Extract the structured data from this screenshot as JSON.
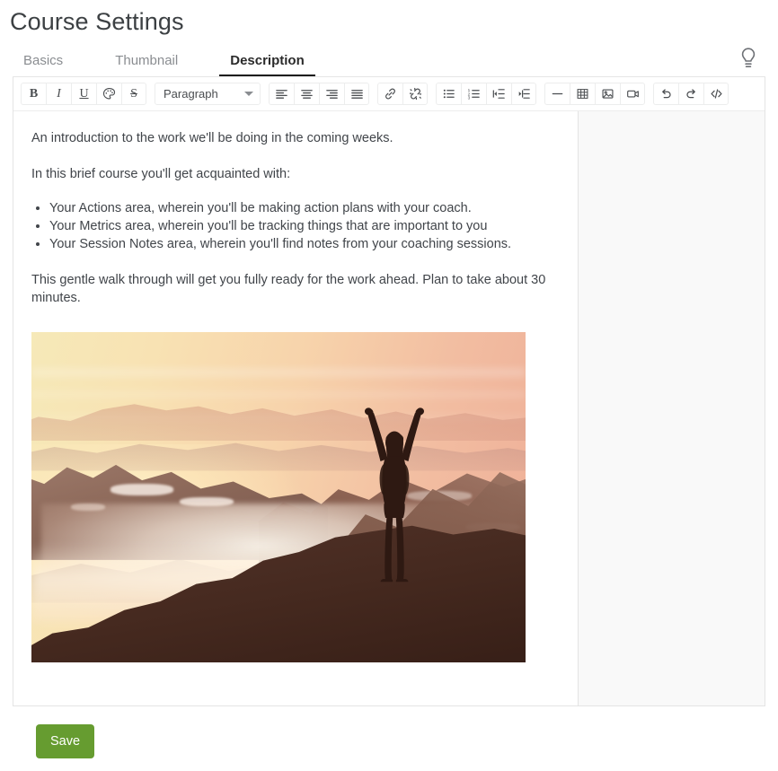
{
  "page": {
    "title": "Course Settings"
  },
  "tabs": [
    {
      "label": "Basics",
      "active": false
    },
    {
      "label": "Thumbnail",
      "active": false
    },
    {
      "label": "Description",
      "active": true
    }
  ],
  "header_actions": {
    "hint_icon": "lightbulb-icon"
  },
  "toolbar": {
    "groups": [
      {
        "name": "text-format",
        "buttons": [
          {
            "name": "bold-button",
            "label": "B",
            "icon": "bold-icon"
          },
          {
            "name": "italic-button",
            "label": "I",
            "icon": "italic-icon"
          },
          {
            "name": "underline-button",
            "label": "U",
            "icon": "underline-icon"
          },
          {
            "name": "text-color-button",
            "label": "",
            "icon": "palette-icon"
          },
          {
            "name": "strikethrough-button",
            "label": "S",
            "icon": "strikethrough-icon"
          }
        ]
      },
      {
        "name": "block-format",
        "select": {
          "name": "paragraph-format-select",
          "value": "Paragraph"
        }
      },
      {
        "name": "alignment",
        "buttons": [
          {
            "name": "align-left-button",
            "icon": "align-left-icon"
          },
          {
            "name": "align-center-button",
            "icon": "align-center-icon"
          },
          {
            "name": "align-right-button",
            "icon": "align-right-icon"
          },
          {
            "name": "align-justify-button",
            "icon": "align-justify-icon"
          }
        ]
      },
      {
        "name": "links",
        "buttons": [
          {
            "name": "insert-link-button",
            "icon": "link-icon"
          },
          {
            "name": "remove-link-button",
            "icon": "unlink-icon"
          }
        ]
      },
      {
        "name": "lists",
        "buttons": [
          {
            "name": "bullet-list-button",
            "icon": "bullet-list-icon"
          },
          {
            "name": "numbered-list-button",
            "icon": "numbered-list-icon"
          },
          {
            "name": "outdent-button",
            "icon": "outdent-icon"
          },
          {
            "name": "indent-button",
            "icon": "indent-icon"
          }
        ]
      },
      {
        "name": "insert",
        "buttons": [
          {
            "name": "horizontal-rule-button",
            "icon": "horizontal-rule-icon"
          },
          {
            "name": "insert-table-button",
            "icon": "table-icon"
          },
          {
            "name": "insert-image-button",
            "icon": "image-icon"
          },
          {
            "name": "insert-video-button",
            "icon": "video-icon"
          }
        ]
      },
      {
        "name": "history",
        "buttons": [
          {
            "name": "undo-button",
            "icon": "undo-icon"
          },
          {
            "name": "redo-button",
            "icon": "redo-icon"
          },
          {
            "name": "source-code-button",
            "icon": "code-icon"
          }
        ]
      }
    ]
  },
  "content": {
    "intro": "An introduction to the work we'll be doing in the coming weeks.",
    "lead_in": "In this brief course you'll get acquainted with:",
    "bullets": [
      "Your Actions area, wherein you'll be making action plans with your coach.",
      "Your Metrics area, wherein you'll be tracking things that are important to you",
      "Your Session Notes area, wherein you'll find notes from your coaching sessions."
    ],
    "closing": "This gentle walk through will get you fully ready for the work ahead.  Plan to take about 30 minutes.",
    "image": {
      "name": "hero-image",
      "alt": "Silhouette of a person with arms raised standing on a mountain peak above a misty valley at sunset"
    }
  },
  "footer": {
    "save_label": "Save"
  },
  "colors": {
    "accent_green": "#669c30",
    "active_tab_underline": "#1c1c1c",
    "border": "#e4e4e4",
    "side_panel": "#f9f9f9",
    "text": "#41454a",
    "muted_text": "#8a8d91"
  }
}
